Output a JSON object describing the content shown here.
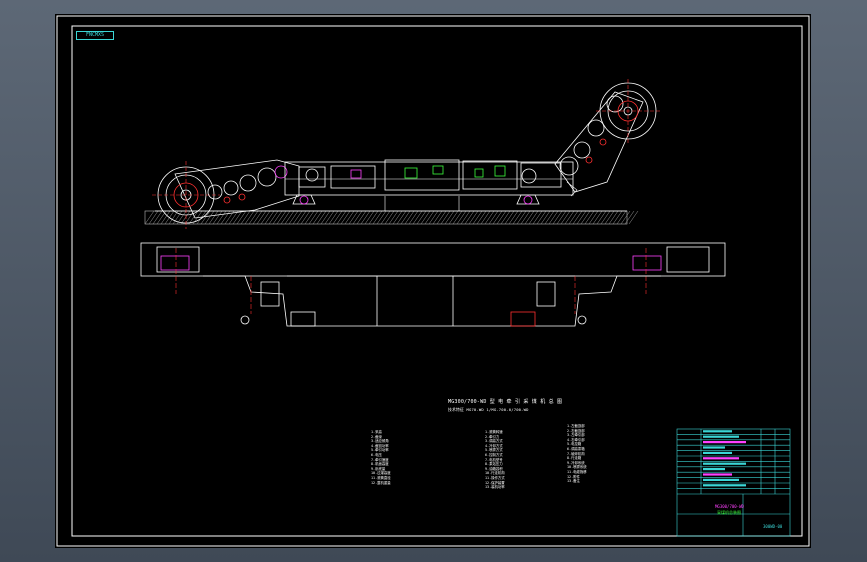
{
  "sheet": {
    "stamp": "FNCMXS",
    "notes_title_1": "MG300/700-WD 型 电 牵 引 采 煤 机 总 图",
    "notes_title_2": "技术特征 MG70-WD 1/MG-700-0/700-WD",
    "notes_left": [
      "1.采高",
      "2.截深",
      "3.适应倾角",
      "4.截割功率",
      "5.牵引功率",
      "6.电压",
      "7.牵引速度",
      "8.机面高度",
      "9.卧底量",
      "10.过煤高度",
      "11.滚筒直径",
      "12.整机重量"
    ],
    "notes_mid": [
      "1.滚筒转速",
      "2.牵引力",
      "3.调高方式",
      "4.冷却方式",
      "5.喷雾方式",
      "6.控制方式",
      "7.电机型号",
      "8.泵站压力",
      "9.油箱容积",
      "10.行走机构",
      "11.操作方式",
      "12.保护装置",
      "13.装机功率"
    ],
    "notes_right": [
      "1.左截割部",
      "2.右截割部",
      "3.左牵引部",
      "4.右牵引部",
      "5.电控箱",
      "6.调高泵箱",
      "7.破碎机构",
      "8.行走箱",
      "9.冷却系统",
      "10.喷雾系统",
      "11.电缆拖移",
      "12.附件",
      "13.备注"
    ],
    "title_block": {
      "drawing_name": "MG300/700-WD",
      "subtitle": "采煤机总装图",
      "drawing_number": "300WD-00"
    }
  },
  "colors": {
    "paper": "#000000",
    "frame": "#ffffff",
    "dimension": "#ff2a2a",
    "centerline": "#ff3030",
    "accent_cyan": "#3bd6d6",
    "accent_magenta": "#ff40ff",
    "accent_green": "#3cff3c",
    "title_block": "#3bd6d6"
  }
}
